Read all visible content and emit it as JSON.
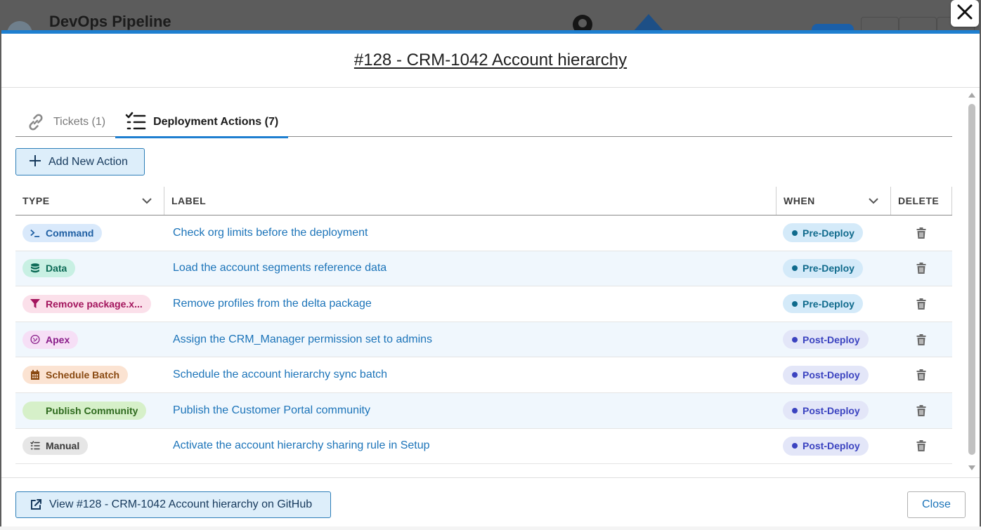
{
  "background": {
    "app_title": "DevOps Pipeline"
  },
  "modal": {
    "title": "#128 - CRM-1042 Account hierarchy",
    "tabs": [
      {
        "label": "Tickets (1)",
        "icon": "link-icon",
        "active": false
      },
      {
        "label": "Deployment Actions (7)",
        "icon": "checklist-icon",
        "active": true
      }
    ],
    "add_button_label": "Add New Action",
    "table": {
      "columns": [
        "TYPE",
        "LABEL",
        "WHEN",
        "DELETE"
      ],
      "rows": [
        {
          "type": "Command",
          "type_icon": "terminal-icon",
          "type_bg": "#d9e9fb",
          "type_fg": "#1f5fa3",
          "label": "Check org limits before the deployment",
          "when": "Pre-Deploy"
        },
        {
          "type": "Data",
          "type_icon": "database-icon",
          "type_bg": "#c8f0e3",
          "type_fg": "#0b6a55",
          "label": "Load the account segments reference data",
          "when": "Pre-Deploy"
        },
        {
          "type": "Remove package.x...",
          "type_icon": "filter-icon",
          "type_bg": "#fbe0ea",
          "type_fg": "#a3155d",
          "label": "Remove profiles from the delta package",
          "when": "Pre-Deploy"
        },
        {
          "type": "Apex",
          "type_icon": "apex-icon",
          "type_bg": "#f6dff6",
          "type_fg": "#8a1e8a",
          "label": "Assign the CRM_Manager permission set to admins",
          "when": "Post-Deploy"
        },
        {
          "type": "Schedule Batch",
          "type_icon": "calendar-icon",
          "type_bg": "#fbe3d2",
          "type_fg": "#8a4a12",
          "label": "Schedule the account hierarchy sync batch",
          "when": "Post-Deploy"
        },
        {
          "type": "Publish Community",
          "type_icon": "",
          "type_bg": "#d6f0c9",
          "type_fg": "#2e6a1e",
          "label": "Publish the Customer Portal community",
          "when": "Post-Deploy"
        },
        {
          "type": "Manual",
          "type_icon": "checklist-icon",
          "type_bg": "#e6e6e6",
          "type_fg": "#3a3a3a",
          "label": "Activate the account hierarchy sharing rule in Setup",
          "when": "Post-Deploy"
        }
      ]
    },
    "when_styles": {
      "Pre-Deploy": {
        "bg": "#d4eaf9",
        "fg": "#0f6a8c"
      },
      "Post-Deploy": {
        "bg": "#e3e6f8",
        "fg": "#3b43c0"
      }
    },
    "footer": {
      "github_button_label": "View #128 - CRM-1042 Account hierarchy on GitHub",
      "close_button_label": "Close"
    }
  }
}
